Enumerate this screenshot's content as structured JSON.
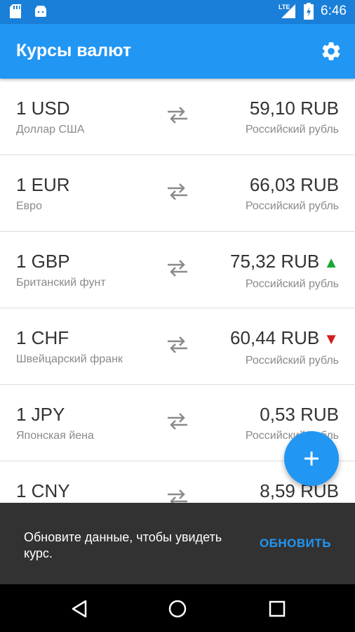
{
  "status_bar": {
    "time": "6:46",
    "network": "LTE",
    "icons": [
      "sd-card-icon",
      "android-icon",
      "signal-icon",
      "battery-icon"
    ]
  },
  "app_bar": {
    "title": "Курсы валют",
    "settings_icon": "gear-icon"
  },
  "rates": [
    {
      "code": "1 USD",
      "name": "Доллар США",
      "value": "59,10 RUB",
      "target_name": "Российский рубль",
      "trend": ""
    },
    {
      "code": "1 EUR",
      "name": "Евро",
      "value": "66,03 RUB",
      "target_name": "Российский рубль",
      "trend": ""
    },
    {
      "code": "1 GBP",
      "name": "Британский фунт",
      "value": "75,32 RUB",
      "target_name": "Российский рубль",
      "trend": "up"
    },
    {
      "code": "1 CHF",
      "name": "Швейцарский франк",
      "value": "60,44 RUB",
      "target_name": "Российский рубль",
      "trend": "down"
    },
    {
      "code": "1 JPY",
      "name": "Японская йена",
      "value": "0,53 RUB",
      "target_name": "Российский рубль",
      "trend": ""
    },
    {
      "code": "1 CNY",
      "name": "",
      "value": "8,59 RUB",
      "target_name": "",
      "trend": ""
    }
  ],
  "fab": {
    "icon": "plus-icon"
  },
  "snackbar": {
    "message": "Обновите данные, чтобы увидеть курс.",
    "action": "ОБНОВИТЬ"
  },
  "colors": {
    "primary": "#2196f3",
    "primary_dark": "#1a7fd8",
    "trend_up": "#1aa83a",
    "trend_down": "#d21d1d"
  }
}
